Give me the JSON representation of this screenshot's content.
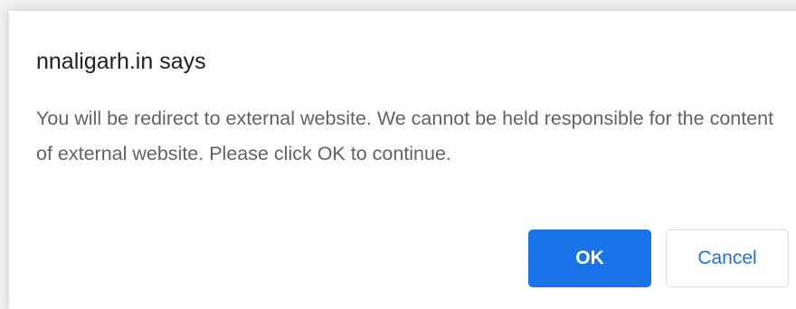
{
  "dialog": {
    "title": "nnaligarh.in says",
    "message": "You will be redirect to external website. We cannot be held responsible for the content of external website. Please click OK to continue.",
    "ok_label": "OK",
    "cancel_label": "Cancel"
  },
  "colors": {
    "primary": "#1a73e8",
    "text": "#202124",
    "secondary_text": "#5f6368"
  }
}
